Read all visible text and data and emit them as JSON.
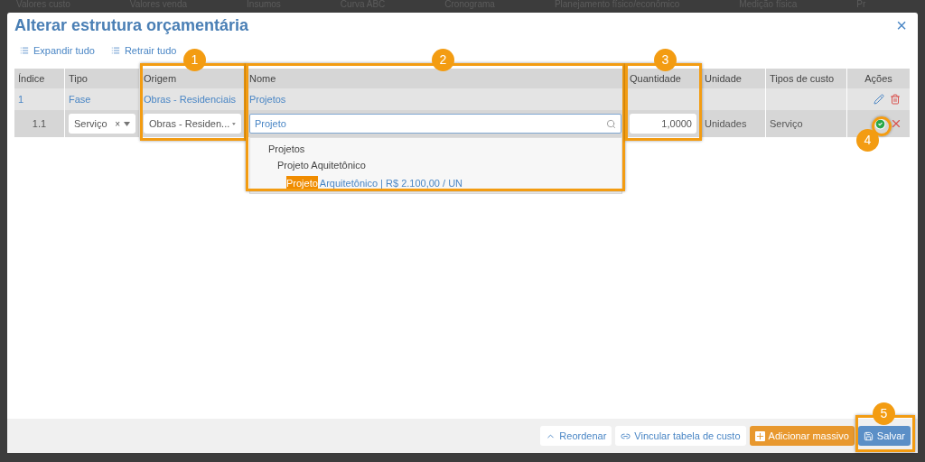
{
  "background_tabs": [
    "Valores custo",
    "Valores venda",
    "Insumos",
    "Curva ABC",
    "Cronograma",
    "Planejamento físico/econômico",
    "Medição física",
    "Pr"
  ],
  "dialog": {
    "title": "Alterar estrutura orçamentária",
    "close": "×",
    "toolbar": [
      "Expandir tudo",
      "Retrair tudo"
    ],
    "table": {
      "columns": [
        "Índice",
        "Tipo",
        "Origem",
        "Nome",
        "Quantidade",
        "Unidade",
        "Tipos de custo",
        "Ações"
      ],
      "rows": [
        {
          "kind": "group",
          "index": "1",
          "tipo": "Fase",
          "origem": "Obras - Residenciais",
          "nome": "Projetos"
        },
        {
          "kind": "editing",
          "index": "1.1",
          "tipo": "Serviço",
          "tipo_clear": "×",
          "origem": "Obras - Residen...",
          "nome": "Projeto",
          "quantidade": "1,0000",
          "unidade": "Unidades",
          "tipos_de_custo": "Serviço"
        }
      ]
    },
    "search_results": [
      {
        "label": "Projetos",
        "children": [
          {
            "label": "Projeto Aquitetônico",
            "children": [
              {
                "match": "Projeto",
                "rest": "Arquitetônico | R$ 2.100,00 / UN"
              }
            ]
          }
        ]
      }
    ],
    "footer_buttons": [
      {
        "label": "Reordenar",
        "kind": "plain"
      },
      {
        "label": "Vincular tabela de custo",
        "kind": "plain"
      },
      {
        "label": "Adicionar massivo",
        "kind": "accent"
      },
      {
        "label": "Salvar",
        "kind": "primary"
      }
    ]
  },
  "annotations": [
    "1",
    "2",
    "3",
    "4",
    "5"
  ]
}
